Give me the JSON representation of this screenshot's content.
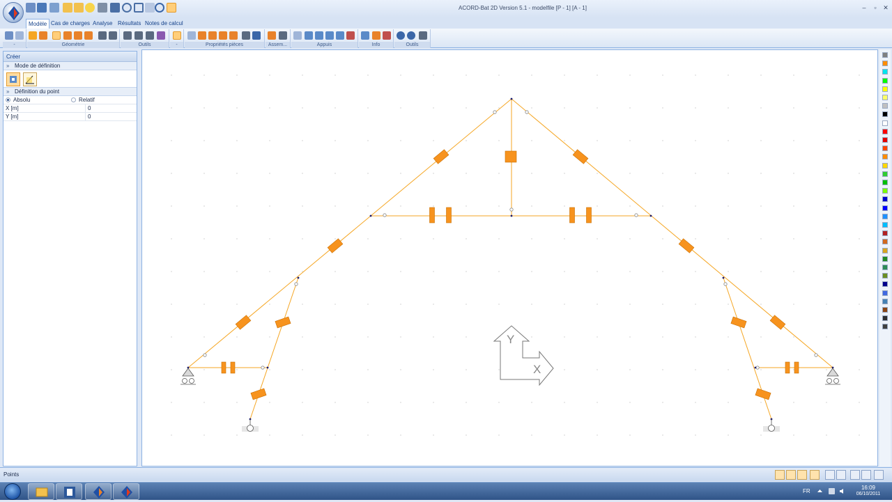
{
  "titlebar": {
    "window_title": "ACORD-Bat 2D Version 5.1 - modelfile [P - 1] [A - 1]",
    "minimize": "–",
    "maximize": "▫",
    "close": "✕"
  },
  "ribbon": {
    "tabs": [
      "Modèle",
      "Cas de charges",
      "Analyse",
      "Résultats",
      "Notes de calcul"
    ],
    "groups": [
      "-",
      "Géométrie",
      "Outils",
      "-",
      "Propriétés pièces",
      "Assem...",
      "Appuis",
      "Info",
      "Outils"
    ]
  },
  "left_panel": {
    "header": "Créer",
    "mode_section": "Mode de définition",
    "point_section": "Définition du point",
    "absolu_label": "Absolu",
    "relatif_label": "Relatif",
    "x_label": "X [m]",
    "x_value": "0",
    "y_label": "Y [m]",
    "y_value": "0"
  },
  "canvas": {
    "axis_y_label": "Y",
    "axis_x_label": "X",
    "colors": {
      "member": "#f5a623",
      "section_mark": "#f7931e",
      "section_mark_border": "#c96e00",
      "node": "#1a1a6e",
      "hinge": "#888888",
      "grid_dot": "#c8c8c8"
    }
  },
  "palette": {
    "colors": [
      "#808080",
      "#ff8c00",
      "#00e5ee",
      "#00ff00",
      "#ffff00",
      "#ffff66",
      "#c0c0c0",
      "#000000",
      "#ffffff",
      "#ff0000",
      "#e60000",
      "#ff4500",
      "#ff8c00",
      "#ffd700",
      "#32cd32",
      "#00c000",
      "#7cfc00",
      "#0000cd",
      "#0000ff",
      "#1e90ff",
      "#00bfff",
      "#b22222",
      "#d2691e",
      "#daa520",
      "#228b22",
      "#2e8b57",
      "#6b8e23",
      "#00008b",
      "#4169e1",
      "#4682b4",
      "#8b4513",
      "#2f2f2f",
      "#404040"
    ]
  },
  "statusbar": {
    "text": "Points"
  },
  "taskbar": {
    "lang": "FR",
    "time": "16:09",
    "date": "06/10/2011"
  }
}
